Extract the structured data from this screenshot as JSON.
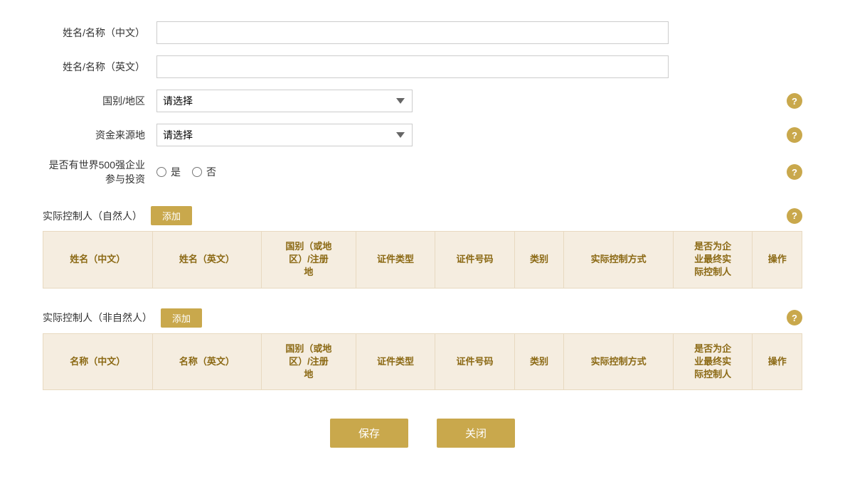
{
  "form": {
    "name_cn_label": "姓名/名称（中文）",
    "name_en_label": "姓名/名称（英文）",
    "country_label": "国别/地区",
    "fund_source_label": "资金来源地",
    "fortune500_label": "是否有世界500强企业参与投资",
    "name_cn_value": "",
    "name_en_value": "",
    "country_placeholder": "请选择",
    "fund_source_placeholder": "请选择",
    "radio_yes": "是",
    "radio_no": "否"
  },
  "natural_person_section": {
    "title": "实际控制人（自然人）",
    "add_label": "添加",
    "help_icon": "?",
    "columns": [
      "姓名（中文）",
      "姓名（英文）",
      "国别（或地\n区）/注册\n地",
      "证件类型",
      "证件号码",
      "类别",
      "实际控制方式",
      "是否为企\n业最终实\n际控制人",
      "操作"
    ]
  },
  "non_natural_person_section": {
    "title": "实际控制人（非自然人）",
    "add_label": "添加",
    "help_icon": "?",
    "columns": [
      "名称（中文）",
      "名称（英文）",
      "国别（或地\n区）/注册\n地",
      "证件类型",
      "证件号码",
      "类别",
      "实际控制方式",
      "是否为企\n业最终实\n际控制人",
      "操作"
    ]
  },
  "buttons": {
    "save": "保存",
    "close": "关闭"
  },
  "help_icon_text": "?"
}
